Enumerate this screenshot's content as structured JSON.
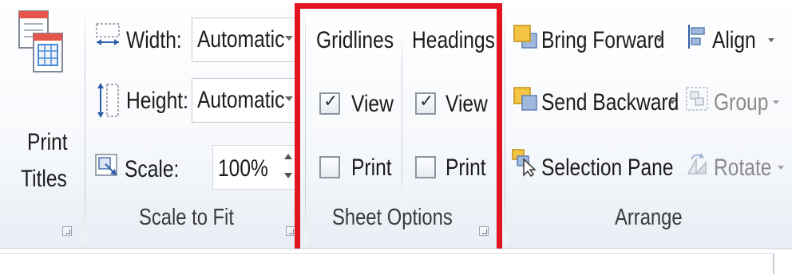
{
  "page_setup": {
    "print_titles": {
      "line1": "Print",
      "line2": "Titles"
    }
  },
  "scale_to_fit": {
    "width_label": "Width:",
    "width_value": "Automatic",
    "height_label": "Height:",
    "height_value": "Automatic",
    "scale_label": "Scale:",
    "scale_value": "100%",
    "group_label": "Scale to Fit"
  },
  "sheet_options": {
    "gridlines_header": "Gridlines",
    "headings_header": "Headings",
    "gridlines_view": {
      "label": "View",
      "checked": true
    },
    "gridlines_print": {
      "label": "Print",
      "checked": false
    },
    "headings_view": {
      "label": "View",
      "checked": true
    },
    "headings_print": {
      "label": "Print",
      "checked": false
    },
    "group_label": "Sheet Options"
  },
  "arrange": {
    "bring_forward": "Bring Forward",
    "send_backward": "Send Backward",
    "selection_pane": "Selection Pane",
    "align": "Align",
    "group": "Group",
    "rotate": "Rotate",
    "group_label": "Arrange"
  },
  "colors": {
    "highlight_border": "#e0151f",
    "ribbon_bg": "#f7f9fc"
  },
  "icons": [
    "print-titles-icon",
    "width-icon",
    "height-icon",
    "scale-icon",
    "bring-forward-icon",
    "send-backward-icon",
    "selection-pane-icon",
    "align-icon",
    "group-icon",
    "rotate-icon",
    "dialog-launcher-icon"
  ]
}
